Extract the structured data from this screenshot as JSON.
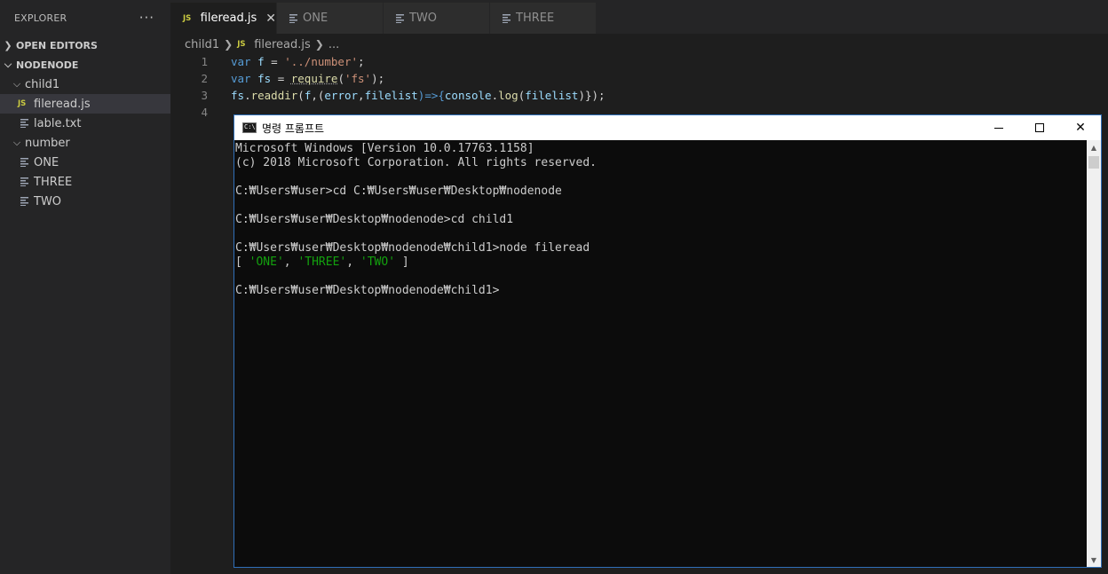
{
  "explorer": {
    "title": "EXPLORER",
    "more": "···",
    "open_editors": "OPEN EDITORS",
    "project": "NODENODE",
    "items": [
      {
        "label": "child1",
        "kind": "folder"
      },
      {
        "label": "fileread.js",
        "kind": "js"
      },
      {
        "label": "lable.txt",
        "kind": "text"
      },
      {
        "label": "number",
        "kind": "folder"
      },
      {
        "label": "ONE",
        "kind": "text"
      },
      {
        "label": "THREE",
        "kind": "text"
      },
      {
        "label": "TWO",
        "kind": "text"
      }
    ]
  },
  "tabs": [
    {
      "label": "fileread.js",
      "badge": "JS",
      "close": "✕"
    },
    {
      "label": "ONE"
    },
    {
      "label": "TWO"
    },
    {
      "label": "THREE"
    }
  ],
  "breadcrumb": {
    "folder": "child1",
    "file": "fileread.js",
    "badge": "JS",
    "tail": "..."
  },
  "code": {
    "line_numbers": [
      "1",
      "2",
      "3",
      "4"
    ],
    "line1": {
      "kw": "var",
      "name": "f",
      "eq": " = ",
      "str": "'../number'",
      "end": ";"
    },
    "line2": {
      "kw": "var",
      "name": "fs",
      "eq": " = ",
      "fn": "require",
      "open": "(",
      "str": "'fs'",
      "end": ");"
    },
    "line3": {
      "obj": "fs",
      "dot": ".",
      "fn": "readdir",
      "p1": "(",
      "a1": "f",
      "p2": ",(",
      "a2": "error",
      "c": ",",
      "a3": "filelist",
      "arrow": ")=>{",
      "con": "console",
      "dot2": ".",
      "log": "log",
      "p3": "(",
      "a4": "filelist",
      "end": ")});"
    }
  },
  "cmd": {
    "title": "명령 프롬프트",
    "minimize": "minimize",
    "maximize": "maximize",
    "close": "✕",
    "lines": [
      "Microsoft Windows [Version 10.0.17763.1158]",
      "(c) 2018 Microsoft Corporation. All rights reserved.",
      "",
      "C:₩Users₩user>cd C:₩Users₩user₩Desktop₩nodenode",
      "",
      "C:₩Users₩user₩Desktop₩nodenode>cd child1",
      "",
      "C:₩Users₩user₩Desktop₩nodenode₩child1>node fileread"
    ],
    "output": {
      "open": "[ ",
      "items": [
        "'ONE'",
        "'THREE'",
        "'TWO'"
      ],
      "sep": ", ",
      "close": " ]"
    },
    "prompt": "C:₩Users₩user₩Desktop₩nodenode₩child1>"
  },
  "colors": {
    "accent": "#2f6fb8",
    "js_badge": "#cbcb41",
    "string": "#ce9178",
    "keyword": "#569cd6",
    "green_output": "#13a10e"
  }
}
